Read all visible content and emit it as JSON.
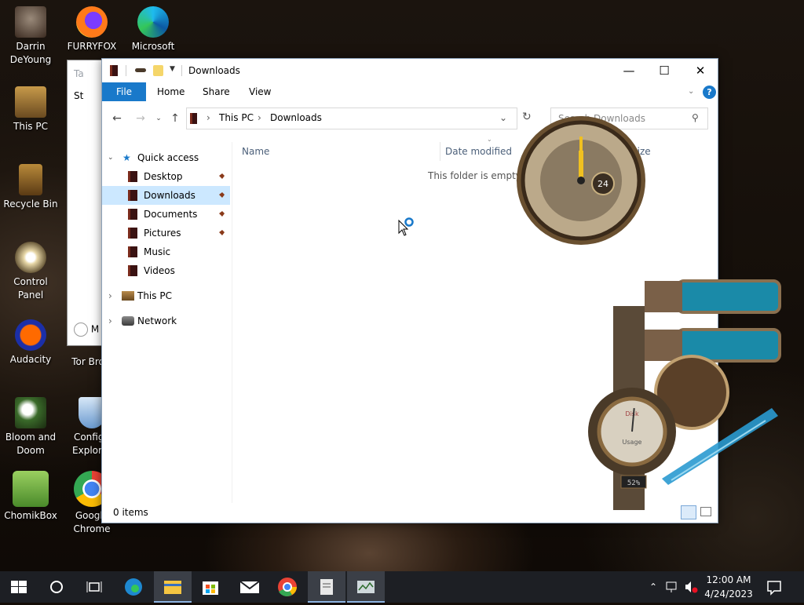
{
  "desktop": {
    "icons": [
      {
        "label": "Darrin\nDeYoung",
        "icon": "user-folder-icon"
      },
      {
        "label": "FURRYFOX",
        "icon": "firefox-icon"
      },
      {
        "label": "Microsoft",
        "icon": "edge-icon"
      },
      {
        "label": "This PC",
        "icon": "computer-icon"
      },
      {
        "label": "Recycle Bin",
        "icon": "recycle-bin-icon"
      },
      {
        "label": "Control Panel",
        "icon": "control-panel-icon"
      },
      {
        "label": "Audacity",
        "icon": "audacity-icon"
      },
      {
        "label": "Tor Brow",
        "icon": "tor-browser-icon"
      },
      {
        "label": "Bloom and\nDoom",
        "icon": "game-icon"
      },
      {
        "label": "Configu\nExplorer",
        "icon": "shield-icon"
      },
      {
        "label": "ChomikBox",
        "icon": "chomikbox-icon"
      },
      {
        "label": "Google\nChrome",
        "icon": "chrome-icon"
      }
    ]
  },
  "background_window": {
    "title_fragment": "Ta",
    "row_fragment": "St",
    "bottom_fragment": "M"
  },
  "explorer": {
    "title": "Downloads",
    "ribbon_tabs": [
      "File",
      "Home",
      "Share",
      "View"
    ],
    "breadcrumb": [
      "This PC",
      "Downloads"
    ],
    "search_placeholder": "Search Downloads",
    "nav": {
      "quick_access": "Quick access",
      "quick_items": [
        "Desktop",
        "Downloads",
        "Documents",
        "Pictures",
        "Music",
        "Videos"
      ],
      "pinned": [
        true,
        false,
        true,
        true,
        false,
        false
      ],
      "this_pc": "This PC",
      "network": "Network"
    },
    "columns": {
      "name": "Name",
      "date_modified": "Date modified",
      "size": "Size"
    },
    "empty_message": "This folder is empty.",
    "status": "0 items",
    "colors": {
      "accent": "#1979ca",
      "selected": "#cce8ff"
    }
  },
  "gadgets": {
    "clock_subdial": "24",
    "gauge_label_top": "Disk",
    "gauge_label_bottom": "Usage",
    "gauge_percent": 52,
    "gauge_readout": "52%"
  },
  "taskbar": {
    "items": [
      "start-icon",
      "search-icon",
      "task-view-icon",
      "edge-icon",
      "file-explorer-icon",
      "store-icon",
      "mail-icon",
      "chrome-icon",
      "notepad-icon",
      "system-monitor-icon"
    ],
    "time": "12:00 AM",
    "date": "4/24/2023"
  }
}
